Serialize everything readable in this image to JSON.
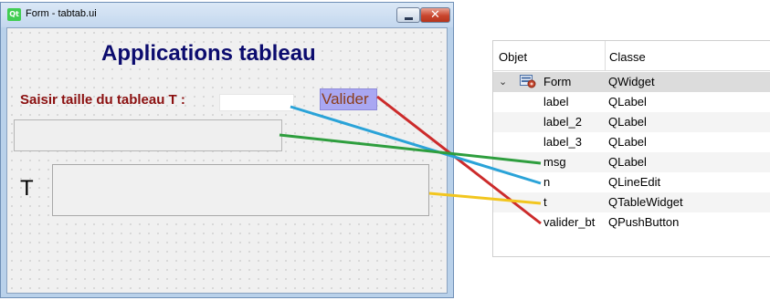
{
  "window": {
    "title": "Form - tabtab.ui",
    "close_glyph": "✕",
    "qt_logo": "Qt"
  },
  "form": {
    "title": "Applications tableau",
    "prompt": "Saisir taille du tableau T :",
    "button_label": "Valider",
    "n_value": "",
    "t_label": "T"
  },
  "inspector": {
    "headers": {
      "object": "Objet",
      "class": "Classe"
    },
    "root": {
      "object": "Form",
      "class": "QWidget"
    },
    "rows": [
      {
        "object": "label",
        "class": "QLabel"
      },
      {
        "object": "label_2",
        "class": "QLabel"
      },
      {
        "object": "label_3",
        "class": "QLabel"
      },
      {
        "object": "msg",
        "class": "QLabel"
      },
      {
        "object": "n",
        "class": "QLineEdit"
      },
      {
        "object": "t",
        "class": "QTableWidget"
      },
      {
        "object": "valider_bt",
        "class": "QPushButton"
      }
    ]
  },
  "links": {
    "valider_bt": "#cc2b2b",
    "n": "#2aa3d8",
    "msg": "#2e9e3e",
    "t": "#f2c61f"
  }
}
